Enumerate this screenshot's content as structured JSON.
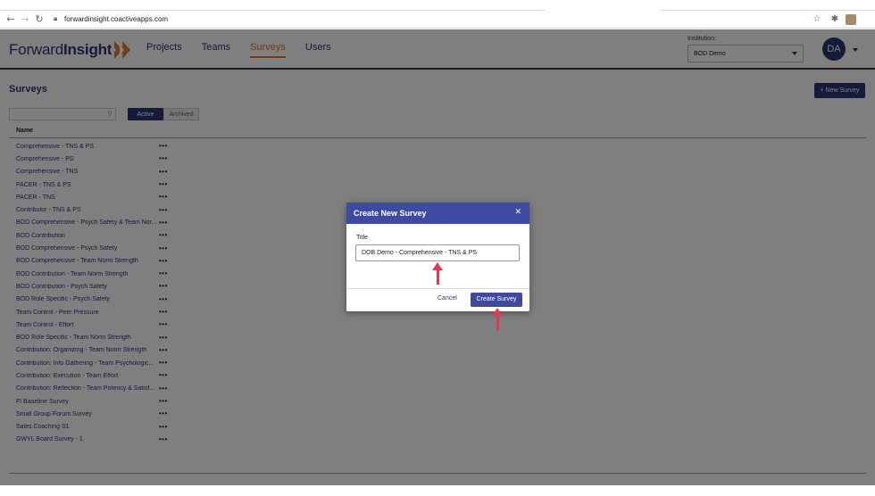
{
  "browser": {
    "url": "forwardinsight.coactiveapps.com"
  },
  "app": {
    "logo_regular": "Forward",
    "logo_bold": "Insight",
    "nav": [
      {
        "label": "Projects"
      },
      {
        "label": "Teams"
      },
      {
        "label": "Surveys"
      },
      {
        "label": "Users"
      }
    ],
    "active_nav": "Surveys",
    "institution_label": "Institution:",
    "institution_value": "BOD Demo",
    "avatar_initials": "DA",
    "accent_color": "#e07a2a",
    "brand_color": "#2c3577"
  },
  "page": {
    "title": "Surveys",
    "new_survey_label": "+ New Survey",
    "search_placeholder": "",
    "toggle": {
      "active": "Active",
      "archived": "Archived"
    },
    "column_name": "Name",
    "surveys": [
      "Comprehensive - TNS & PS",
      "Comprehensive - PS",
      "Comprehensive - TNS",
      "PACER - TNS & PS",
      "PACER - TNS",
      "Contributor - TNS & PS",
      "BOD Comprehensive - Psych Safety & Team Nor...",
      "BOD Contribution",
      "BOD Comprehensive - Psych Safety",
      "BOD Comprehensive - Team Norm Strength",
      "BOD Contribution - Team Norm Strength",
      "BOD Contribution - Psych Safety",
      "BOD Role Specific - Psych Safety",
      "Team Control - Peer Pressure",
      "Team Control - Effort",
      "BOD Role Specific - Team Norm Strength",
      "Contribution: Organizing - Team Norm Strength",
      "Contribution: Info Gathering - Team Psychologic...",
      "Contribution: Execution - Team Effort",
      "Contribution: Reflection - Team Potency & Satisf...",
      "FI Baseline Survey",
      "Small Group Forum Survey",
      "Sales Coaching S1",
      "GWYL Board Survey - 1"
    ],
    "row_menu": "•••"
  },
  "modal": {
    "title": "Create New Survey",
    "close_glyph": "✕",
    "field_label": "Title",
    "field_value": "DOB Demo - Comprehensive - TNS & PS",
    "cancel_label": "Cancel",
    "create_label": "Create Survey"
  }
}
